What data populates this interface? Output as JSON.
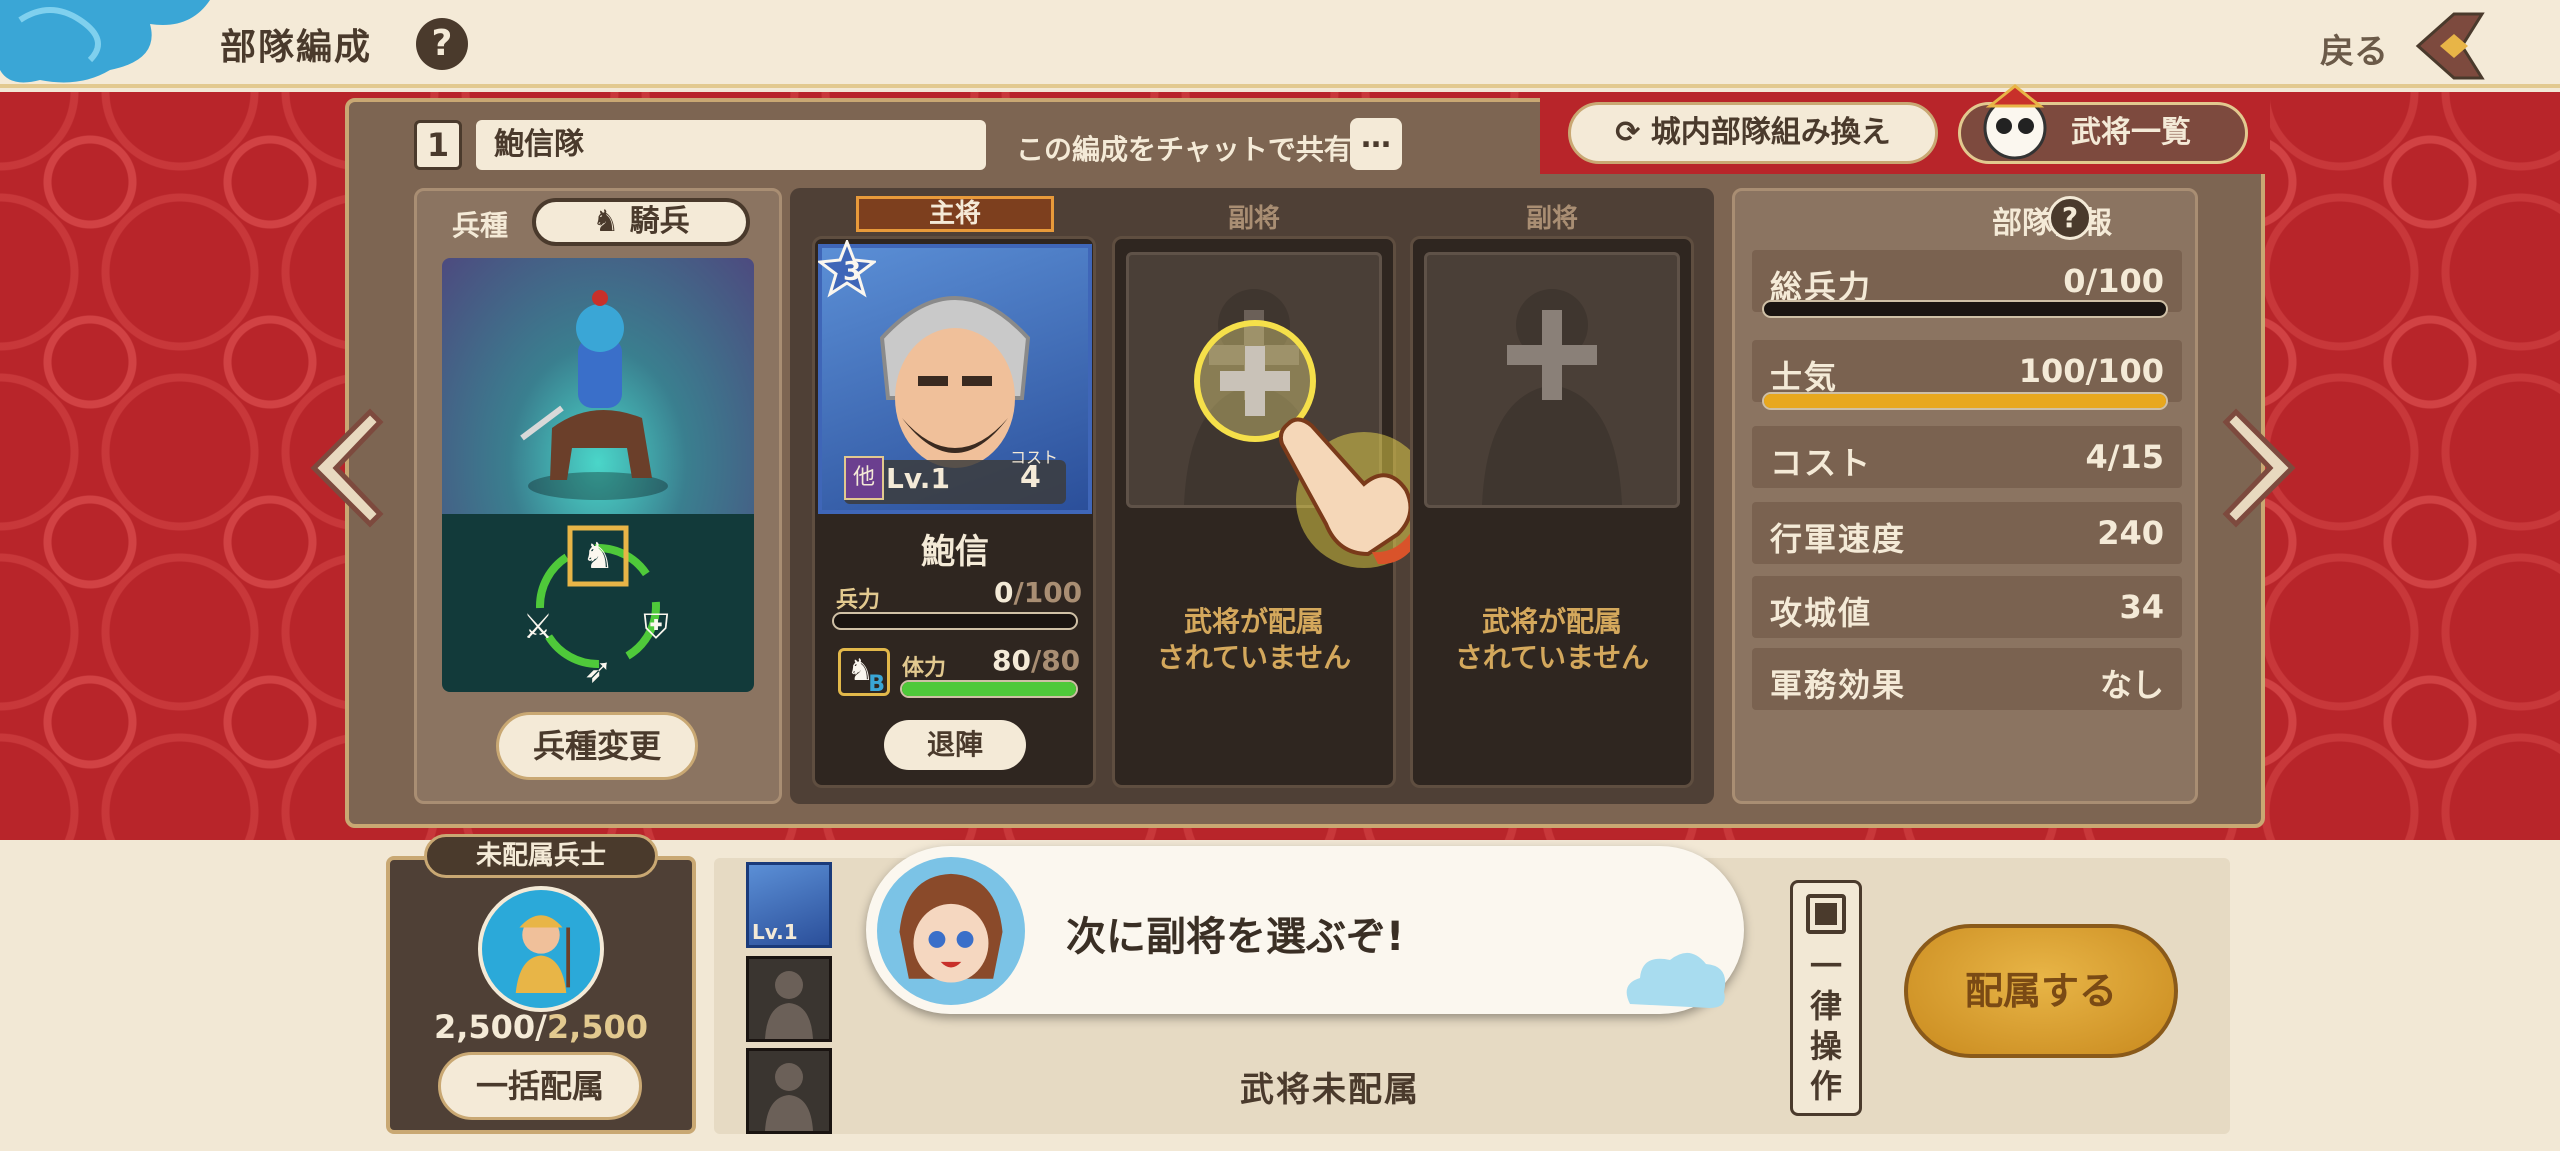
{
  "header": {
    "title": "部隊編成",
    "help_label": "?",
    "back_label": "戻る"
  },
  "team": {
    "number": "1",
    "name": "鮑信隊",
    "share_text": "この編成をチャットで共有",
    "more_label": "…"
  },
  "top_buttons": {
    "reorganize": "城内部隊組み換え",
    "generals_list": "武将一覧"
  },
  "troop": {
    "label": "兵種",
    "type": "騎兵",
    "change_button": "兵種変更"
  },
  "slots": {
    "main_label": "主将",
    "sub_label_1": "副将",
    "sub_label_2": "副将",
    "empty_text_1a": "武将が配属",
    "empty_text_1b": "されていません",
    "empty_text_2a": "武将が配属",
    "empty_text_2b": "されていません"
  },
  "general": {
    "star": "3",
    "faction": "他",
    "level": "Lv.1",
    "cost_label": "コスト",
    "cost": "4",
    "name": "鮑信",
    "troops_label": "兵力",
    "troops_value": "0",
    "troops_max": "/100",
    "troops_fraction": 0,
    "stamina_label": "体力",
    "stamina_value": "80",
    "stamina_max": "/80",
    "stamina_fraction": 1.0,
    "horse_rank": "B",
    "retreat_button": "退陣"
  },
  "info": {
    "title": "部隊情報",
    "help_label": "?",
    "rows": [
      {
        "label": "総兵力",
        "value": "0/100",
        "fraction": 0
      },
      {
        "label": "士気",
        "value": "100/100",
        "fraction": 1.0
      },
      {
        "label": "コスト",
        "value": "4/15"
      },
      {
        "label": "行軍速度",
        "value": "240"
      },
      {
        "label": "攻城値",
        "value": "34"
      },
      {
        "label": "軍務効果",
        "value": "なし"
      }
    ]
  },
  "bottom": {
    "unassigned_tag": "未配属兵士",
    "soldier_count": "2,500/",
    "soldier_max": "2,500",
    "assign_all_button": "一括配属",
    "thumb_level": "Lv.1",
    "bubble_text": "次に副将を選ぶぞ!",
    "no_general_text": "武将未配属",
    "bulk_op_text": "一律操作",
    "assign_button": "配属する"
  },
  "colors": {
    "background_red": "#b8252a",
    "panel_brown": "#7d6552",
    "accent_gold": "#e8a81e",
    "stamina_green": "#4fc93a",
    "cream": "#f4ead7"
  }
}
